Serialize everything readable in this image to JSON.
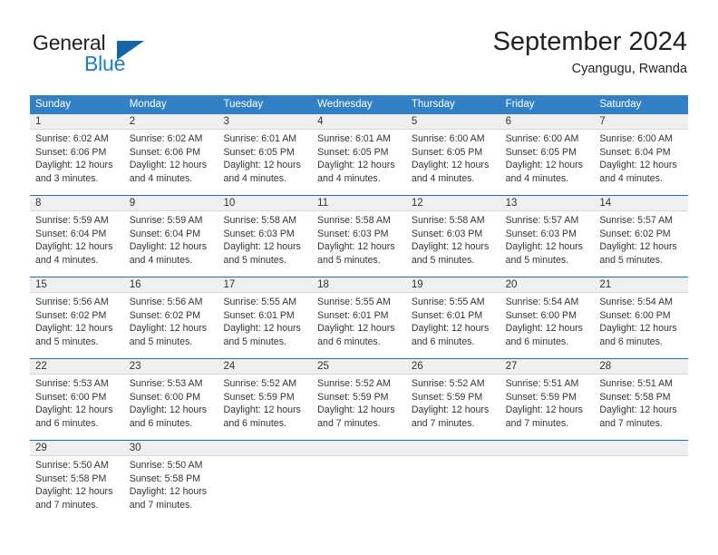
{
  "brand": {
    "name_primary": "General",
    "name_secondary": "Blue",
    "logo_icon": "triangle-logo-icon"
  },
  "header": {
    "title": "September 2024",
    "subtitle": "Cyangugu, Rwanda"
  },
  "colors": {
    "header_blue": "#3281c4",
    "row_divider_blue": "#1e6fb8",
    "day_band_gray": "#efefef",
    "brand_blue": "#1a7fc1",
    "text": "#333333"
  },
  "weekdays": [
    "Sunday",
    "Monday",
    "Tuesday",
    "Wednesday",
    "Thursday",
    "Friday",
    "Saturday"
  ],
  "weeks": [
    [
      {
        "day": "1",
        "sunrise": "Sunrise: 6:02 AM",
        "sunset": "Sunset: 6:06 PM",
        "daylight_line1": "Daylight: 12 hours",
        "daylight_line2": "and 3 minutes."
      },
      {
        "day": "2",
        "sunrise": "Sunrise: 6:02 AM",
        "sunset": "Sunset: 6:06 PM",
        "daylight_line1": "Daylight: 12 hours",
        "daylight_line2": "and 4 minutes."
      },
      {
        "day": "3",
        "sunrise": "Sunrise: 6:01 AM",
        "sunset": "Sunset: 6:05 PM",
        "daylight_line1": "Daylight: 12 hours",
        "daylight_line2": "and 4 minutes."
      },
      {
        "day": "4",
        "sunrise": "Sunrise: 6:01 AM",
        "sunset": "Sunset: 6:05 PM",
        "daylight_line1": "Daylight: 12 hours",
        "daylight_line2": "and 4 minutes."
      },
      {
        "day": "5",
        "sunrise": "Sunrise: 6:00 AM",
        "sunset": "Sunset: 6:05 PM",
        "daylight_line1": "Daylight: 12 hours",
        "daylight_line2": "and 4 minutes."
      },
      {
        "day": "6",
        "sunrise": "Sunrise: 6:00 AM",
        "sunset": "Sunset: 6:05 PM",
        "daylight_line1": "Daylight: 12 hours",
        "daylight_line2": "and 4 minutes."
      },
      {
        "day": "7",
        "sunrise": "Sunrise: 6:00 AM",
        "sunset": "Sunset: 6:04 PM",
        "daylight_line1": "Daylight: 12 hours",
        "daylight_line2": "and 4 minutes."
      }
    ],
    [
      {
        "day": "8",
        "sunrise": "Sunrise: 5:59 AM",
        "sunset": "Sunset: 6:04 PM",
        "daylight_line1": "Daylight: 12 hours",
        "daylight_line2": "and 4 minutes."
      },
      {
        "day": "9",
        "sunrise": "Sunrise: 5:59 AM",
        "sunset": "Sunset: 6:04 PM",
        "daylight_line1": "Daylight: 12 hours",
        "daylight_line2": "and 4 minutes."
      },
      {
        "day": "10",
        "sunrise": "Sunrise: 5:58 AM",
        "sunset": "Sunset: 6:03 PM",
        "daylight_line1": "Daylight: 12 hours",
        "daylight_line2": "and 5 minutes."
      },
      {
        "day": "11",
        "sunrise": "Sunrise: 5:58 AM",
        "sunset": "Sunset: 6:03 PM",
        "daylight_line1": "Daylight: 12 hours",
        "daylight_line2": "and 5 minutes."
      },
      {
        "day": "12",
        "sunrise": "Sunrise: 5:58 AM",
        "sunset": "Sunset: 6:03 PM",
        "daylight_line1": "Daylight: 12 hours",
        "daylight_line2": "and 5 minutes."
      },
      {
        "day": "13",
        "sunrise": "Sunrise: 5:57 AM",
        "sunset": "Sunset: 6:03 PM",
        "daylight_line1": "Daylight: 12 hours",
        "daylight_line2": "and 5 minutes."
      },
      {
        "day": "14",
        "sunrise": "Sunrise: 5:57 AM",
        "sunset": "Sunset: 6:02 PM",
        "daylight_line1": "Daylight: 12 hours",
        "daylight_line2": "and 5 minutes."
      }
    ],
    [
      {
        "day": "15",
        "sunrise": "Sunrise: 5:56 AM",
        "sunset": "Sunset: 6:02 PM",
        "daylight_line1": "Daylight: 12 hours",
        "daylight_line2": "and 5 minutes."
      },
      {
        "day": "16",
        "sunrise": "Sunrise: 5:56 AM",
        "sunset": "Sunset: 6:02 PM",
        "daylight_line1": "Daylight: 12 hours",
        "daylight_line2": "and 5 minutes."
      },
      {
        "day": "17",
        "sunrise": "Sunrise: 5:55 AM",
        "sunset": "Sunset: 6:01 PM",
        "daylight_line1": "Daylight: 12 hours",
        "daylight_line2": "and 5 minutes."
      },
      {
        "day": "18",
        "sunrise": "Sunrise: 5:55 AM",
        "sunset": "Sunset: 6:01 PM",
        "daylight_line1": "Daylight: 12 hours",
        "daylight_line2": "and 6 minutes."
      },
      {
        "day": "19",
        "sunrise": "Sunrise: 5:55 AM",
        "sunset": "Sunset: 6:01 PM",
        "daylight_line1": "Daylight: 12 hours",
        "daylight_line2": "and 6 minutes."
      },
      {
        "day": "20",
        "sunrise": "Sunrise: 5:54 AM",
        "sunset": "Sunset: 6:00 PM",
        "daylight_line1": "Daylight: 12 hours",
        "daylight_line2": "and 6 minutes."
      },
      {
        "day": "21",
        "sunrise": "Sunrise: 5:54 AM",
        "sunset": "Sunset: 6:00 PM",
        "daylight_line1": "Daylight: 12 hours",
        "daylight_line2": "and 6 minutes."
      }
    ],
    [
      {
        "day": "22",
        "sunrise": "Sunrise: 5:53 AM",
        "sunset": "Sunset: 6:00 PM",
        "daylight_line1": "Daylight: 12 hours",
        "daylight_line2": "and 6 minutes."
      },
      {
        "day": "23",
        "sunrise": "Sunrise: 5:53 AM",
        "sunset": "Sunset: 6:00 PM",
        "daylight_line1": "Daylight: 12 hours",
        "daylight_line2": "and 6 minutes."
      },
      {
        "day": "24",
        "sunrise": "Sunrise: 5:52 AM",
        "sunset": "Sunset: 5:59 PM",
        "daylight_line1": "Daylight: 12 hours",
        "daylight_line2": "and 6 minutes."
      },
      {
        "day": "25",
        "sunrise": "Sunrise: 5:52 AM",
        "sunset": "Sunset: 5:59 PM",
        "daylight_line1": "Daylight: 12 hours",
        "daylight_line2": "and 7 minutes."
      },
      {
        "day": "26",
        "sunrise": "Sunrise: 5:52 AM",
        "sunset": "Sunset: 5:59 PM",
        "daylight_line1": "Daylight: 12 hours",
        "daylight_line2": "and 7 minutes."
      },
      {
        "day": "27",
        "sunrise": "Sunrise: 5:51 AM",
        "sunset": "Sunset: 5:59 PM",
        "daylight_line1": "Daylight: 12 hours",
        "daylight_line2": "and 7 minutes."
      },
      {
        "day": "28",
        "sunrise": "Sunrise: 5:51 AM",
        "sunset": "Sunset: 5:58 PM",
        "daylight_line1": "Daylight: 12 hours",
        "daylight_line2": "and 7 minutes."
      }
    ],
    [
      {
        "day": "29",
        "sunrise": "Sunrise: 5:50 AM",
        "sunset": "Sunset: 5:58 PM",
        "daylight_line1": "Daylight: 12 hours",
        "daylight_line2": "and 7 minutes."
      },
      {
        "day": "30",
        "sunrise": "Sunrise: 5:50 AM",
        "sunset": "Sunset: 5:58 PM",
        "daylight_line1": "Daylight: 12 hours",
        "daylight_line2": "and 7 minutes."
      },
      {
        "day": "",
        "sunrise": "",
        "sunset": "",
        "daylight_line1": "",
        "daylight_line2": ""
      },
      {
        "day": "",
        "sunrise": "",
        "sunset": "",
        "daylight_line1": "",
        "daylight_line2": ""
      },
      {
        "day": "",
        "sunrise": "",
        "sunset": "",
        "daylight_line1": "",
        "daylight_line2": ""
      },
      {
        "day": "",
        "sunrise": "",
        "sunset": "",
        "daylight_line1": "",
        "daylight_line2": ""
      },
      {
        "day": "",
        "sunrise": "",
        "sunset": "",
        "daylight_line1": "",
        "daylight_line2": ""
      }
    ]
  ]
}
